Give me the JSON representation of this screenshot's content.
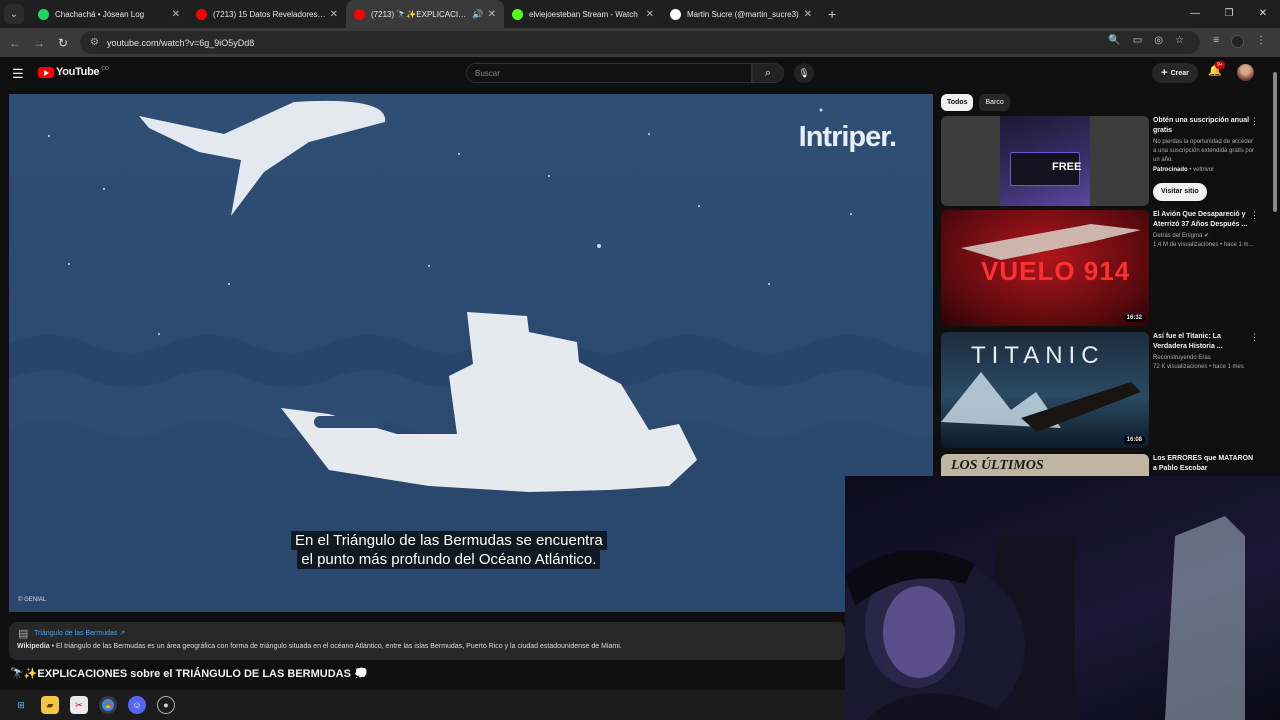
{
  "browser": {
    "tabs": [
      {
        "title": "Chachachá • Jósean Log",
        "fav_color": "#1ed760",
        "active": false,
        "speaker": false
      },
      {
        "title": "(7213) 15 Datos Reveladores Sobre",
        "fav_color": "#ff0000",
        "active": false,
        "speaker": false
      },
      {
        "title": "(7213) 🔭✨EXPLICACIONES",
        "fav_color": "#ff0000",
        "active": true,
        "speaker": true
      },
      {
        "title": "elviejoesteban Stream - Watch",
        "fav_color": "#53fc18",
        "active": false,
        "speaker": false
      },
      {
        "title": "Martin Sucre (@martin_sucre3)",
        "fav_color": "#ffffff",
        "active": false,
        "speaker": false
      }
    ],
    "url": "youtube.com/watch?v=6g_9iO5yDd8"
  },
  "youtube": {
    "logo_text": "YouTube",
    "logo_country": "CO",
    "search_placeholder": "Buscar",
    "create_label": "Crear",
    "notif_badge": "9+"
  },
  "player": {
    "watermark": "Intriper.",
    "subtitle_line1": "En el Triángulo de las Bermudas se encuentra",
    "subtitle_line2": "el punto más profundo del Océano Atlántico.",
    "credit": "© GENIAL"
  },
  "info_panel": {
    "link": "Triángulo de las Bermudas ↗",
    "source": "Wikipedia",
    "text": " • El triángulo de las Bermudas es un área geográfica con forma de triángulo situada en el océano Atlántico, entre las islas Bermudas, Puerto Rico y la ciudad estadounidense de Miami."
  },
  "video_title": "🔭✨EXPLICACIONES sobre el TRIÁNGULO DE LAS BERMUDAS 💭",
  "chips": [
    "Todos",
    "Barco"
  ],
  "ad": {
    "title": "Obtén una suscripción anual gratis",
    "desc": "No pierdas la oportunidad de acceder a una suscripción extendida gratis por un año.",
    "sponsored": "Patrocinado",
    "advertiser": " • veltrivor",
    "cta": "Visitar sitio",
    "thumb_text": "FREE"
  },
  "recs": [
    {
      "title": "El Avión Que Desapareció y Aterrizó 37 Años Después ...",
      "channel": "Detrás del Enigma ✔",
      "stats": "1,4 M de visualizaciones • hace 1 m...",
      "duration": "16:32",
      "thumb_text": "VUELO 914"
    },
    {
      "title": "Así fue el Titanic: La Verdadera Historia ...",
      "channel": "Reconstruyendo Eras",
      "stats": "72 K visualizaciones • hace 1 mes",
      "duration": "16:08",
      "thumb_text": "TITANIC"
    },
    {
      "title": "Los ERRORES que MATARON a Pablo Escobar",
      "channel": "",
      "stats": "",
      "duration": "",
      "thumb_text": "LOS ÚLTIMOS"
    }
  ]
}
